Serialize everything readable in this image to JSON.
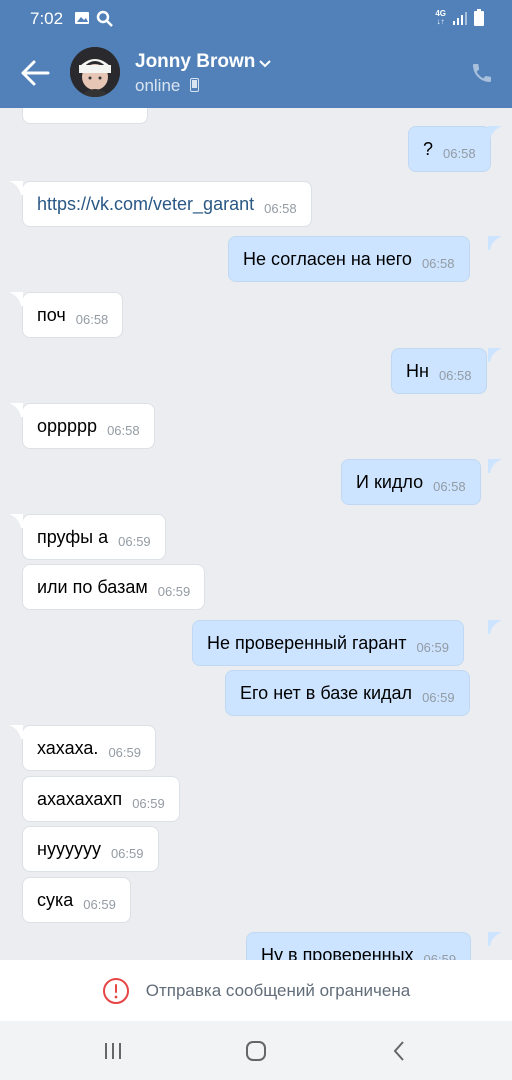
{
  "status_bar": {
    "time": "7:02",
    "network": "4G",
    "icons": [
      "gallery-icon",
      "search-icon",
      "signal-icon",
      "battery-icon"
    ]
  },
  "header": {
    "contact_name": "Jonny Brown",
    "status": "online",
    "icons": [
      "back-arrow-icon",
      "chevron-down-icon",
      "mobile-icon",
      "phone-icon"
    ]
  },
  "messages": [
    {
      "dir": "out",
      "text": "?",
      "time": "06:58"
    },
    {
      "dir": "in",
      "text": "https://vk.com/veter_garant",
      "time": "06:58"
    },
    {
      "dir": "out",
      "text": "Не согласен на него",
      "time": "06:58"
    },
    {
      "dir": "in",
      "text": "поч",
      "time": "06:58"
    },
    {
      "dir": "out",
      "text": "Нн",
      "time": "06:58"
    },
    {
      "dir": "in",
      "text": "орpppp",
      "time": "06:58"
    },
    {
      "dir": "out",
      "text": "И кидло",
      "time": "06:58"
    },
    {
      "dir": "in",
      "text": "пруфы а",
      "time": "06:59"
    },
    {
      "dir": "in",
      "text": "или по базам",
      "time": "06:59"
    },
    {
      "dir": "out",
      "text": "Не проверенный гарант",
      "time": "06:59"
    },
    {
      "dir": "out",
      "text": "Его нет в базе кидал",
      "time": "06:59"
    },
    {
      "dir": "in",
      "text": "хахаха.",
      "time": "06:59"
    },
    {
      "dir": "in",
      "text": "ахахахахп",
      "time": "06:59"
    },
    {
      "dir": "in",
      "text": "нуууууу",
      "time": "06:59"
    },
    {
      "dir": "in",
      "text": "сука",
      "time": "06:59"
    },
    {
      "dir": "out",
      "text": "Ну в проверенных",
      "time": "06:59"
    }
  ],
  "restriction": {
    "text": "Отправка сообщений ограничена",
    "icon": "warning-circle-icon"
  },
  "nav": {
    "icons": [
      "recent-apps-icon",
      "home-icon",
      "back-icon"
    ]
  },
  "colors": {
    "header": "#5181b8",
    "incoming_bubble": "#ffffff",
    "outgoing_bubble": "#cce4ff",
    "warning": "#e64646",
    "link": "#2a5885"
  }
}
